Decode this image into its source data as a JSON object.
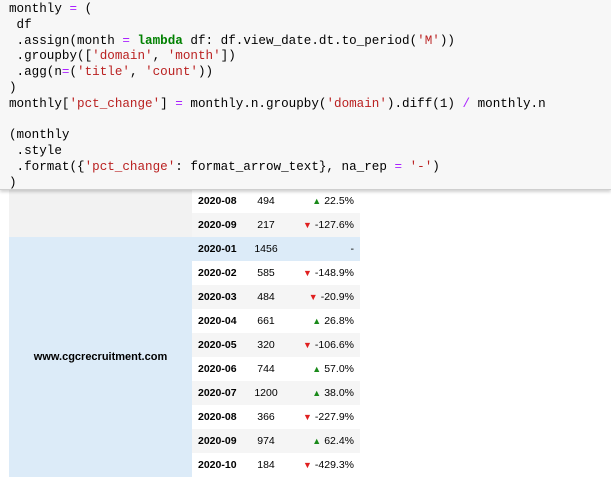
{
  "code": {
    "lines": [
      [
        {
          "t": "monthly "
        },
        {
          "t": "=",
          "c": "tok-op"
        },
        {
          "t": " ("
        }
      ],
      [
        {
          "t": " df"
        }
      ],
      [
        {
          "t": " .assign(month "
        },
        {
          "t": "=",
          "c": "tok-op"
        },
        {
          "t": " "
        },
        {
          "t": "lambda",
          "c": "tok-kw"
        },
        {
          "t": " df: df.view_date.dt.to_period("
        },
        {
          "t": "'M'",
          "c": "tok-str"
        },
        {
          "t": "))"
        }
      ],
      [
        {
          "t": " .groupby(["
        },
        {
          "t": "'domain'",
          "c": "tok-str"
        },
        {
          "t": ", "
        },
        {
          "t": "'month'",
          "c": "tok-str"
        },
        {
          "t": "])"
        }
      ],
      [
        {
          "t": " .agg(n"
        },
        {
          "t": "=",
          "c": "tok-op"
        },
        {
          "t": "("
        },
        {
          "t": "'title'",
          "c": "tok-str"
        },
        {
          "t": ", "
        },
        {
          "t": "'count'",
          "c": "tok-str"
        },
        {
          "t": "))"
        }
      ],
      [
        {
          "t": ")"
        }
      ],
      [
        {
          "t": "monthly["
        },
        {
          "t": "'pct_change'",
          "c": "tok-str"
        },
        {
          "t": "] "
        },
        {
          "t": "=",
          "c": "tok-op"
        },
        {
          "t": " monthly.n.groupby("
        },
        {
          "t": "'domain'",
          "c": "tok-str"
        },
        {
          "t": ").diff(1) "
        },
        {
          "t": "/",
          "c": "tok-op"
        },
        {
          "t": " monthly.n"
        }
      ],
      [
        {
          "t": ""
        }
      ],
      [
        {
          "t": "(monthly"
        }
      ],
      [
        {
          "t": " .style"
        }
      ],
      [
        {
          "t": " .format({"
        },
        {
          "t": "'pct_change'",
          "c": "tok-str"
        },
        {
          "t": ": format_arrow_text}, na_rep "
        },
        {
          "t": "=",
          "c": "tok-op"
        },
        {
          "t": " "
        },
        {
          "t": "'-'",
          "c": "tok-str"
        },
        {
          "t": ")"
        }
      ],
      [
        {
          "t": ")"
        }
      ]
    ]
  },
  "table": {
    "groups": [
      {
        "domain": "",
        "rows": [
          {
            "month": "2020-08",
            "n": "494",
            "pct": "22.5%",
            "dir": "up"
          },
          {
            "month": "2020-09",
            "n": "217",
            "pct": "-127.6%",
            "dir": "down"
          }
        ]
      },
      {
        "domain": "www.cgcrecruitment.com",
        "rows": [
          {
            "month": "2020-01",
            "n": "1456",
            "pct": "-",
            "dir": "none"
          },
          {
            "month": "2020-02",
            "n": "585",
            "pct": "-148.9%",
            "dir": "down"
          },
          {
            "month": "2020-03",
            "n": "484",
            "pct": "-20.9%",
            "dir": "down"
          },
          {
            "month": "2020-04",
            "n": "661",
            "pct": "26.8%",
            "dir": "up"
          },
          {
            "month": "2020-05",
            "n": "320",
            "pct": "-106.6%",
            "dir": "down"
          },
          {
            "month": "2020-06",
            "n": "744",
            "pct": "57.0%",
            "dir": "up"
          },
          {
            "month": "2020-07",
            "n": "1200",
            "pct": "38.0%",
            "dir": "up"
          },
          {
            "month": "2020-08",
            "n": "366",
            "pct": "-227.9%",
            "dir": "down"
          },
          {
            "month": "2020-09",
            "n": "974",
            "pct": "62.4%",
            "dir": "up"
          },
          {
            "month": "2020-10",
            "n": "184",
            "pct": "-429.3%",
            "dir": "down"
          }
        ]
      }
    ],
    "icons": {
      "up": "up-arrow-icon",
      "down": "down-arrow-icon"
    },
    "colors": {
      "up": "#1a8a1a",
      "down": "#e02020",
      "highlight": "#dcebf8"
    }
  }
}
